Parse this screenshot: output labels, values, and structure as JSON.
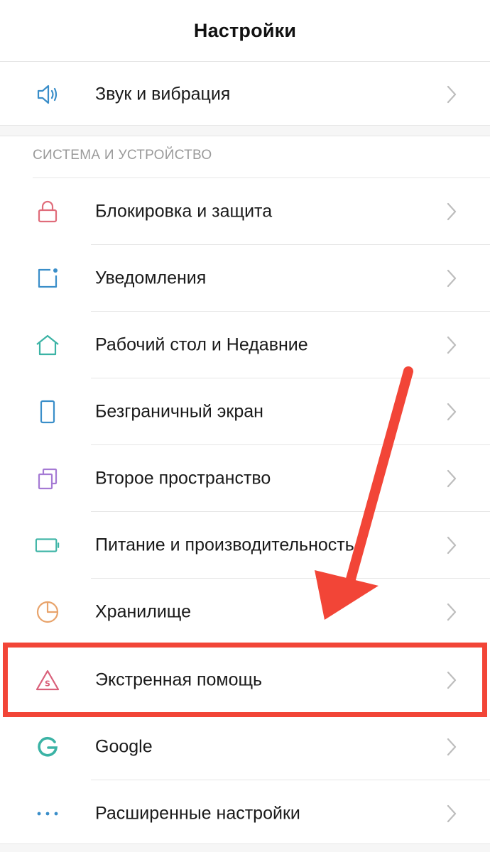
{
  "header": {
    "title": "Настройки"
  },
  "top_section": {
    "items": [
      {
        "label": "Звук и вибрация",
        "icon": "speaker-icon"
      }
    ]
  },
  "system_section": {
    "title": "СИСТЕМА И УСТРОЙСТВО",
    "items": [
      {
        "label": "Блокировка и защита",
        "icon": "lock-icon"
      },
      {
        "label": "Уведомления",
        "icon": "notification-icon"
      },
      {
        "label": "Рабочий стол и Недавние",
        "icon": "home-icon"
      },
      {
        "label": "Безграничный экран",
        "icon": "phone-screen-icon"
      },
      {
        "label": "Второе пространство",
        "icon": "second-space-icon"
      },
      {
        "label": "Питание и производительность",
        "icon": "battery-icon"
      },
      {
        "label": "Хранилище",
        "icon": "storage-pie-icon"
      },
      {
        "label": "Экстренная помощь",
        "icon": "sos-triangle-icon"
      },
      {
        "label": "Google",
        "icon": "google-icon"
      },
      {
        "label": "Расширенные настройки",
        "icon": "more-dots-icon"
      }
    ]
  },
  "colors": {
    "highlight": "#f24537",
    "arrow": "#f24537",
    "sound_icon": "#3a8ec9",
    "lock_icon": "#e06c7a",
    "notification_icon": "#3a8ec9",
    "home_icon": "#3bb3a5",
    "screen_icon": "#3a8ec9",
    "second_space_icon": "#a57ad4",
    "battery_icon": "#3bb3a5",
    "storage_icon": "#e8a36b",
    "sos_icon": "#d9607a",
    "google_icon": "#3bb3a5",
    "more_icon": "#3a8ec9"
  }
}
